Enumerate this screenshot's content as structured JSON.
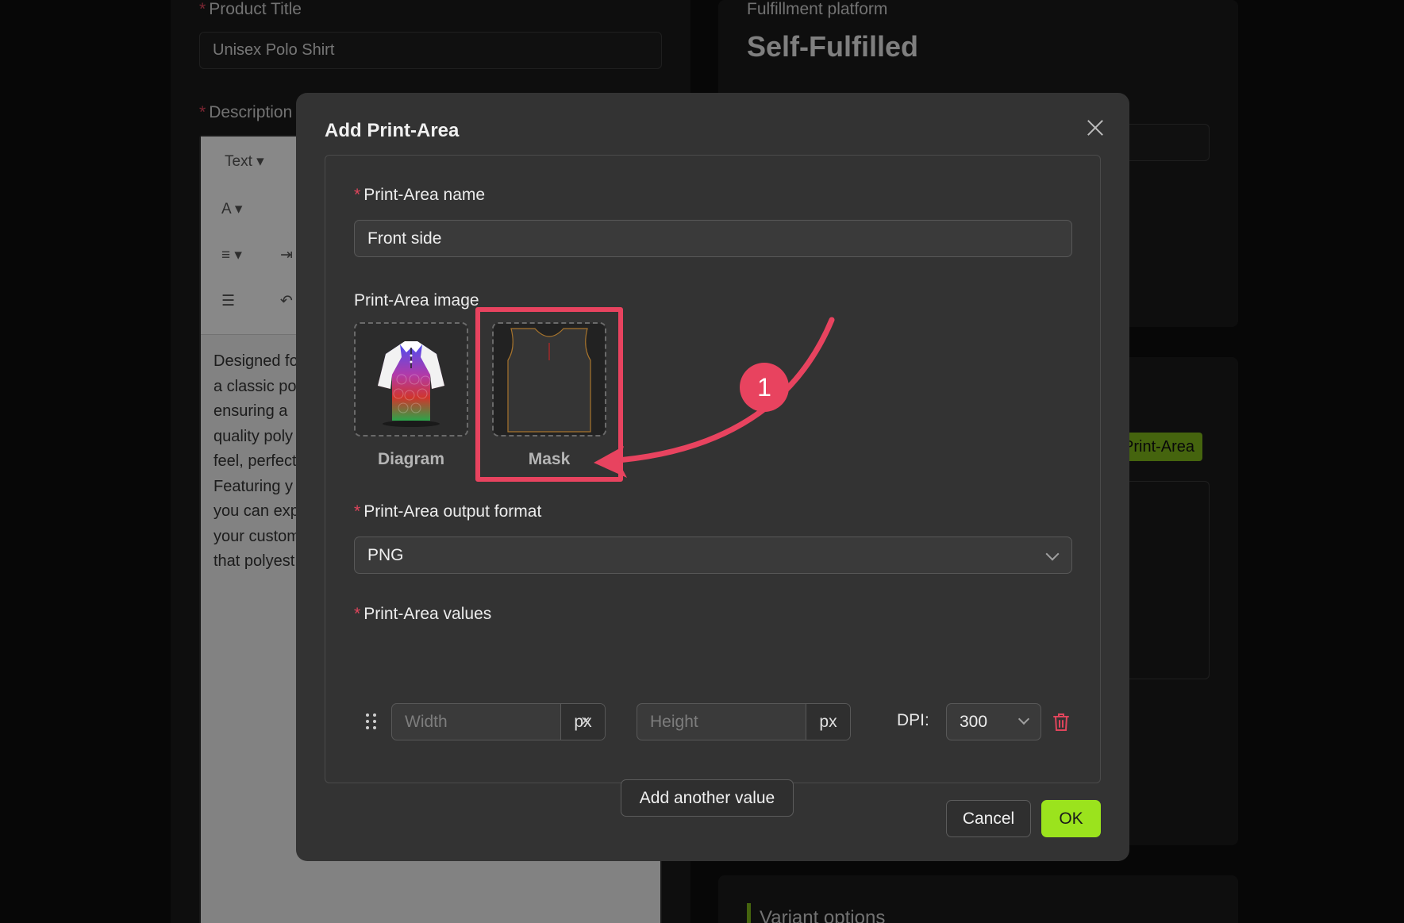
{
  "background": {
    "product_title_label": "Product Title",
    "product_title_value": "Unisex Polo Shirt",
    "description_label": "Description",
    "editor_toolbar": {
      "text_style": "Text ▾",
      "font_color": "A ▾",
      "align": "≡ ▾",
      "indent": "⇥",
      "line": "☰",
      "undo": "↶"
    },
    "description_lines": [
      "Designed fo",
      "a classic po",
      "ensuring a",
      "quality poly",
      "feel, perfect",
      "Featuring y",
      "you can exp",
      "your custom",
      "that polyest"
    ],
    "fulfillment_label": "Fulfillment platform",
    "fulfillment_value": "Self-Fulfilled",
    "print_area_button": "Print-Area",
    "variant_options_label": "Variant options"
  },
  "modal": {
    "title": "Add Print-Area",
    "name_label": "Print-Area name",
    "name_value": "Front side",
    "image_label": "Print-Area image",
    "images": [
      {
        "caption": "Diagram",
        "icon": "polo-shirt-diagram"
      },
      {
        "caption": "Mask",
        "icon": "shirt-mask"
      }
    ],
    "annotation_number": "1",
    "output_format_label": "Print-Area output format",
    "output_format_value": "PNG",
    "values_label": "Print-Area values",
    "width_placeholder": "Width",
    "height_placeholder": "Height",
    "unit": "px",
    "times": "×",
    "dpi_label": "DPI:",
    "dpi_value": "300",
    "add_value_button": "Add another value",
    "cancel_button": "Cancel",
    "ok_button": "OK"
  },
  "colors": {
    "accent_green": "#9be31d",
    "annotation_red": "#e8435f",
    "required_red": "#e0455c"
  }
}
